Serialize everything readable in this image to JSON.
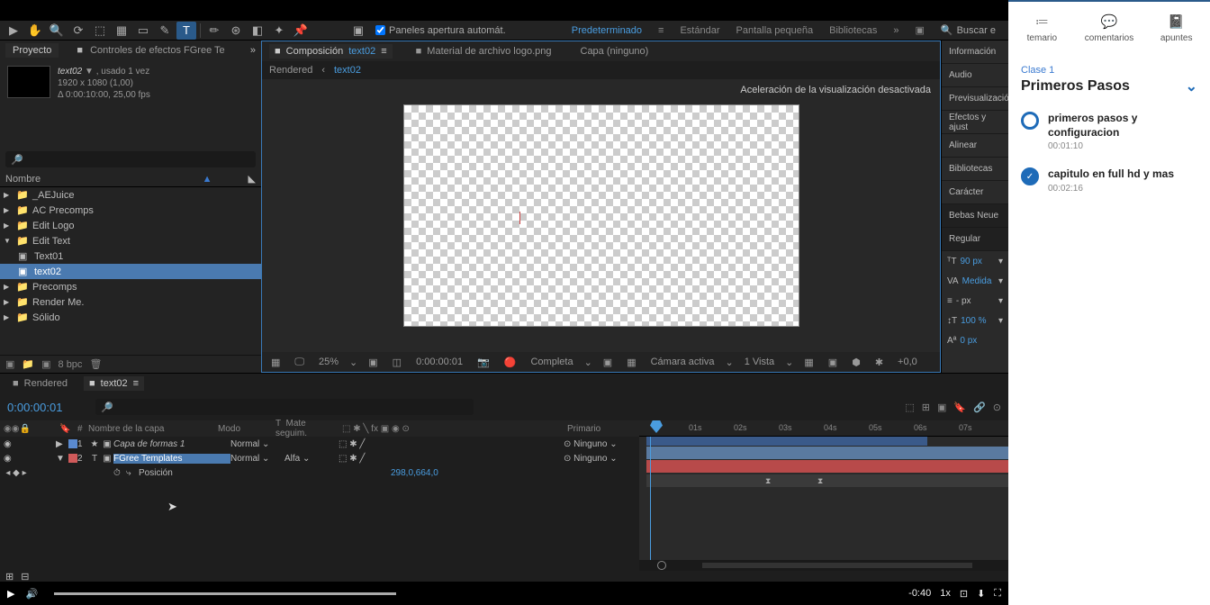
{
  "toolbar": {
    "auto_open_label": "Paneles apertura automát.",
    "workspaces": [
      "Predeterminado",
      "Estándar",
      "Pantalla pequeña",
      "Bibliotecas"
    ],
    "search_label": "Buscar e"
  },
  "panels": {
    "project": "Proyecto",
    "effect_controls": "Controles de efectos FGree Te"
  },
  "project_info": {
    "name": "text02",
    "used": ", usado 1 vez",
    "dims": "1920 x 1080 (1,00)",
    "fps": "Δ 0:00:10:00, 25,00 fps"
  },
  "proj_cols": {
    "name": "Nombre"
  },
  "tree": {
    "i0": "_AEJuice",
    "i1": "AC Precomps",
    "i2": "Edit Logo",
    "i3": "Edit Text",
    "i3a": "Text01",
    "i3b": "text02",
    "i4": "Precomps",
    "i5": "Render Me.",
    "i6": "Sólido"
  },
  "proj_footer": {
    "bpc": "8 bpc"
  },
  "comp": {
    "tab_comp": "Composición",
    "tab_comp_name": "text02",
    "tab_footage": "Material de archivo logo.png",
    "tab_layer": "Capa (ninguno)",
    "bc_rendered": "Rendered",
    "bc_current": "text02",
    "accel_msg": "Aceleración de la visualización desactivada"
  },
  "comp_footer": {
    "zoom": "25%",
    "time": "0:00:00:01",
    "res": "Completa",
    "camera": "Cámara activa",
    "views": "1 Vista",
    "exposure": "+0,0"
  },
  "right_panels": {
    "info": "Información",
    "audio": "Audio",
    "preview": "Previsualizació",
    "effects": "Efectos y ajust",
    "align": "Alinear",
    "libraries": "Bibliotecas",
    "character": "Carácter",
    "font": "Bebas Neue",
    "weight": "Regular",
    "size": "90 px",
    "kerning": "Medida",
    "leading": "- px",
    "vscale": "100 %",
    "baseline": "0 px"
  },
  "timeline": {
    "tab_rendered": "Rendered",
    "tab_text02": "text02",
    "current_time": "0:00:00:01",
    "cols": {
      "source": "Nombre de la capa",
      "mode": "Modo",
      "track": "Mate seguim.",
      "parent": "Primario"
    },
    "layer1": {
      "num": "1",
      "name": "Capa de formas 1",
      "mode": "Normal",
      "parent": "Ninguno"
    },
    "layer2": {
      "num": "2",
      "name": "FGree Templates",
      "mode": "Normal",
      "track": "Alfa",
      "parent": "Ninguno",
      "prop": "Posición",
      "pos_val": "298,0,664,0"
    },
    "ruler": [
      "01s",
      "02s",
      "03s",
      "04s",
      "05s",
      "06s",
      "07s"
    ]
  },
  "bottom": {
    "time": "-0:40",
    "speed": "1x"
  },
  "learning": {
    "tab1": "temario",
    "tab2": "comentarios",
    "tab3": "apuntes",
    "clase": "Clase 1",
    "title": "Primeros Pasos",
    "item1": "primeros pasos y configuracion",
    "dur1": "00:01:10",
    "item2": "capitulo en full hd y mas",
    "dur2": "00:02:16"
  }
}
